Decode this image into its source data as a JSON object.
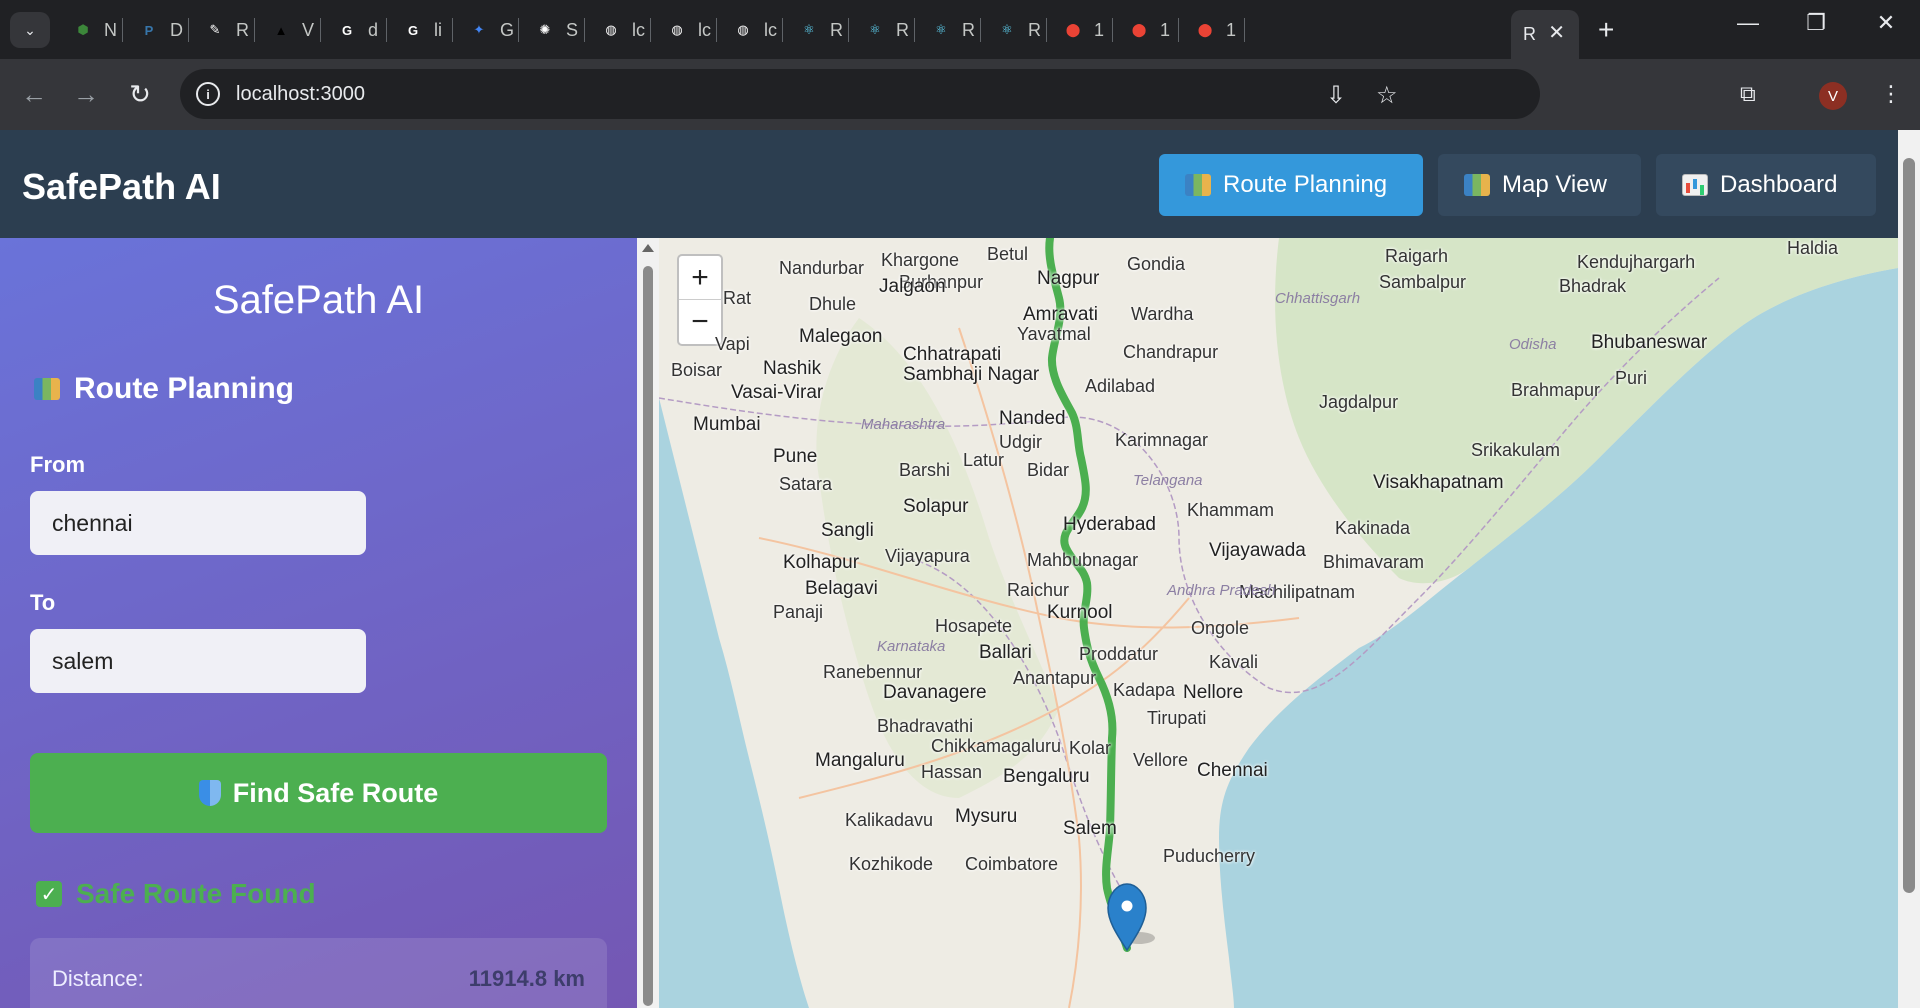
{
  "browser": {
    "tabs": [
      {
        "letter": "N",
        "color": "#3c873a",
        "glyph": "⬢"
      },
      {
        "letter": "D",
        "color": "#3776ab",
        "glyph": "P"
      },
      {
        "letter": "R",
        "color": "#ffffff",
        "glyph": "✎"
      },
      {
        "letter": "V",
        "color": "#000000",
        "glyph": "▲"
      },
      {
        "letter": "d",
        "color": "#ffffff",
        "glyph": "G"
      },
      {
        "letter": "li",
        "color": "#ffffff",
        "glyph": "G"
      },
      {
        "letter": "G",
        "color": "#4285f4",
        "glyph": "✦"
      },
      {
        "letter": "S",
        "color": "#ffffff",
        "glyph": "✺"
      },
      {
        "letter": "lc",
        "color": "#ffffff",
        "glyph": "◍"
      },
      {
        "letter": "lc",
        "color": "#ffffff",
        "glyph": "◍"
      },
      {
        "letter": "lc",
        "color": "#ffffff",
        "glyph": "◍"
      },
      {
        "letter": "R",
        "color": "#61dafb",
        "glyph": "⚛"
      },
      {
        "letter": "R",
        "color": "#61dafb",
        "glyph": "⚛"
      },
      {
        "letter": "R",
        "color": "#61dafb",
        "glyph": "⚛"
      },
      {
        "letter": "R",
        "color": "#61dafb",
        "glyph": "⚛"
      },
      {
        "letter": "1",
        "color": "#ea4335",
        "glyph": "⬤"
      },
      {
        "letter": "1",
        "color": "#ea4335",
        "glyph": "⬤"
      },
      {
        "letter": "1",
        "color": "#ea4335",
        "glyph": "⬤"
      }
    ],
    "active_tab": "R",
    "url": "localhost:3000",
    "profile_initial": "V"
  },
  "app": {
    "brand": "SafePath AI",
    "nav": [
      {
        "label": "Route Planning",
        "icon": "map-icon",
        "active": true
      },
      {
        "label": "Map View",
        "icon": "map-icon",
        "active": false
      },
      {
        "label": "Dashboard",
        "icon": "bar-chart-icon",
        "active": false
      }
    ]
  },
  "sidebar": {
    "title": "SafePath AI",
    "section_title": "Route Planning",
    "from_label": "From",
    "from_value": "chennai",
    "to_label": "To",
    "to_value": "salem",
    "find_button": "Find Safe Route",
    "status": "Safe Route Found",
    "distance_label": "Distance:",
    "distance_value": "11914.8 km"
  },
  "map": {
    "zoom_in": "+",
    "zoom_out": "−",
    "cities": [
      "Nagpur",
      "Gondia",
      "Raigarh",
      "Kendujhargarh",
      "Haldia",
      "Khargone",
      "Betul",
      "Nandurbar",
      "Burhanpur",
      "Jalgaon",
      "Sambalpur",
      "Bhadrak",
      "Dhule",
      "Amravati",
      "Wardha",
      "Rat",
      "Malegaon",
      "Yavatmal",
      "Chhattisgarh",
      "Vapi",
      "Chhatrapati",
      "Sambhaji Nagar",
      "Chandrapur",
      "Odisha",
      "Bhubaneswar",
      "Boisar",
      "Nashik",
      "Puri",
      "Vasai-Virar",
      "Adilabad",
      "Brahmapur",
      "Mumbai",
      "Nanded",
      "Jagdalpur",
      "Maharashtra",
      "Pune",
      "Udgir",
      "Karimnagar",
      "Srikakulam",
      "Latur",
      "Satara",
      "Barshi",
      "Bidar",
      "Telangana",
      "Visakhapatnam",
      "Solapur",
      "Khammam",
      "Hyderabad",
      "Sangli",
      "Kakinada",
      "Vijayawada",
      "Kolhapur",
      "Vijayapura",
      "Mahbubnagar",
      "Bhimavaram",
      "Belagavi",
      "Raichur",
      "Machilipatnam",
      "Andhra Pradesh",
      "Panaji",
      "Kurnool",
      "Ongole",
      "Hosapete",
      "Ballari",
      "Karnataka",
      "Proddatur",
      "Ranebennur",
      "Kavali",
      "Anantapur",
      "Davanagere",
      "Kadapa",
      "Nellore",
      "Tirupati",
      "Bhadravathi",
      "Chikkamagaluru",
      "Kolar",
      "Mangaluru",
      "Hassan",
      "Vellore",
      "Chennai",
      "Bengaluru",
      "Mysuru",
      "Kalikadavu",
      "Salem",
      "Puducherry",
      "Kozhikode",
      "Coimbatore"
    ]
  }
}
